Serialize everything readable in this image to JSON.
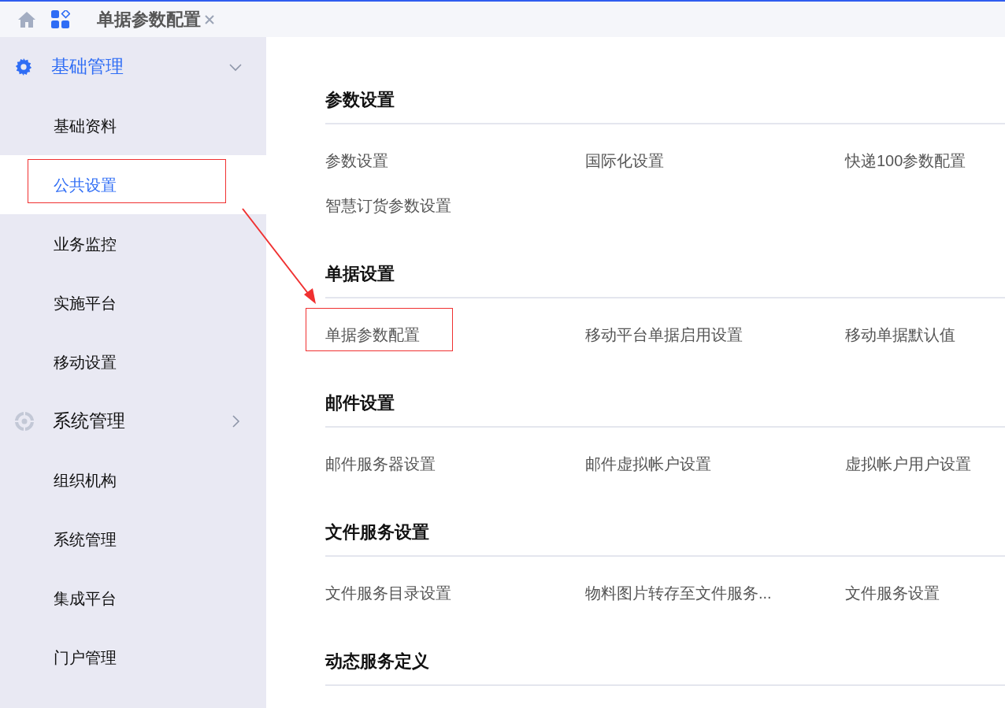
{
  "tab_bar": {
    "tabs": [
      {
        "label": "单据参数配置",
        "selected": true
      }
    ]
  },
  "sidebar": {
    "groups": [
      {
        "label": "基础管理",
        "expanded": true,
        "active": true,
        "items": [
          {
            "label": "基础资料",
            "selected": false,
            "annotated": false
          },
          {
            "label": "公共设置",
            "selected": true,
            "annotated": true
          },
          {
            "label": "业务监控",
            "selected": false,
            "annotated": false
          },
          {
            "label": "实施平台",
            "selected": false,
            "annotated": false
          },
          {
            "label": "移动设置",
            "selected": false,
            "annotated": false
          }
        ]
      },
      {
        "label": "系统管理",
        "expanded": false,
        "active": false,
        "items": [
          {
            "label": "组织机构",
            "selected": false,
            "annotated": false
          },
          {
            "label": "系统管理",
            "selected": false,
            "annotated": false
          },
          {
            "label": "集成平台",
            "selected": false,
            "annotated": false
          },
          {
            "label": "门户管理",
            "selected": false,
            "annotated": false
          }
        ]
      }
    ]
  },
  "sections": [
    {
      "title": "参数设置",
      "items": [
        {
          "label": "参数设置",
          "annotated": false
        },
        {
          "label": "国际化设置",
          "annotated": false
        },
        {
          "label": "快递100参数配置",
          "annotated": false
        },
        {
          "label": "智慧订货参数设置",
          "annotated": false
        }
      ]
    },
    {
      "title": "单据设置",
      "items": [
        {
          "label": "单据参数配置",
          "annotated": true
        },
        {
          "label": "移动平台单据启用设置",
          "annotated": false
        },
        {
          "label": "移动单据默认值",
          "annotated": false
        }
      ]
    },
    {
      "title": "邮件设置",
      "items": [
        {
          "label": "邮件服务器设置",
          "annotated": false
        },
        {
          "label": "邮件虚拟帐户设置",
          "annotated": false
        },
        {
          "label": "虚拟帐户用户设置",
          "annotated": false
        }
      ]
    },
    {
      "title": "文件服务设置",
      "items": [
        {
          "label": "文件服务目录设置",
          "annotated": false
        },
        {
          "label": "物料图片转存至文件服务...",
          "annotated": false
        },
        {
          "label": "文件服务设置",
          "annotated": false
        }
      ]
    },
    {
      "title": "动态服务定义"
    }
  ]
}
